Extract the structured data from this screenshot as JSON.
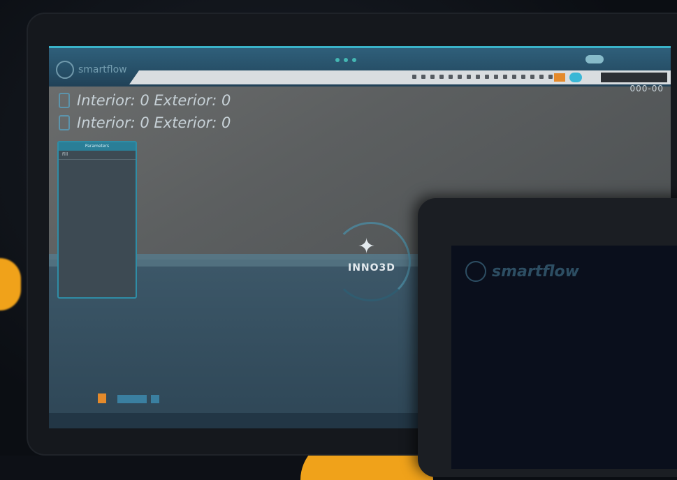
{
  "app": {
    "brand": "smartflow"
  },
  "view_controls": {
    "text": "000-00"
  },
  "stats": [
    {
      "icon": "door-icon",
      "text": "Interior: 0 Exterior: 0"
    },
    {
      "icon": "window-icon",
      "text": "Interior: 0 Exterior: 0"
    }
  ],
  "panel": {
    "title": "Parameters",
    "rows": [
      "Fill",
      "",
      "",
      ""
    ]
  },
  "loader": {
    "label": "INNO3D"
  },
  "tablet": {
    "brand": "smartflow"
  },
  "colors": {
    "accent": "#3ab3c9",
    "orange": "#f0a21a",
    "toolbar": "#d9dde0"
  }
}
